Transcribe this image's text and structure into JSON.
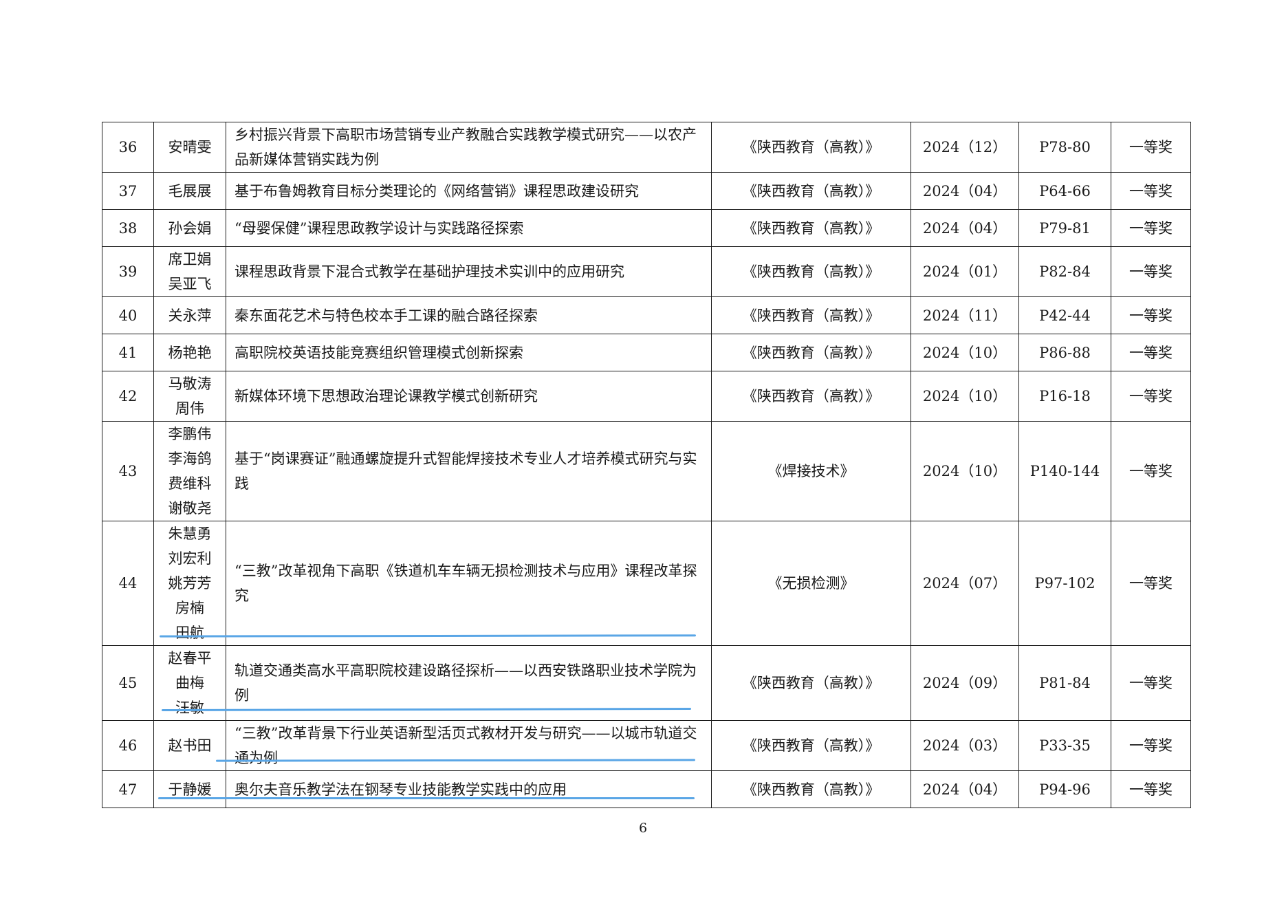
{
  "rows": [
    {
      "no": "36",
      "authors": [
        "安晴雯"
      ],
      "title": "乡村振兴背景下高职市场营销专业产教融合实践教学模式研究——以农产品新媒体营销实践为例",
      "journal": "《陕西教育（高教）》",
      "issue": "2024（12）",
      "pages": "P78-80",
      "award": "一等奖"
    },
    {
      "no": "37",
      "authors": [
        "毛展展"
      ],
      "title": "基于布鲁姆教育目标分类理论的《网络营销》课程思政建设研究",
      "journal": "《陕西教育（高教）》",
      "issue": "2024（04）",
      "pages": "P64-66",
      "award": "一等奖"
    },
    {
      "no": "38",
      "authors": [
        "孙会娟"
      ],
      "title": "“母婴保健”课程思政教学设计与实践路径探索",
      "journal": "《陕西教育（高教）》",
      "issue": "2024（04）",
      "pages": "P79-81",
      "award": "一等奖"
    },
    {
      "no": "39",
      "authors": [
        "席卫娟",
        "吴亚飞"
      ],
      "title": "课程思政背景下混合式教学在基础护理技术实训中的应用研究",
      "journal": "《陕西教育（高教）》",
      "issue": "2024（01）",
      "pages": "P82-84",
      "award": "一等奖"
    },
    {
      "no": "40",
      "authors": [
        "关永萍"
      ],
      "title": "秦东面花艺术与特色校本手工课的融合路径探索",
      "journal": "《陕西教育（高教）》",
      "issue": "2024（11）",
      "pages": "P42-44",
      "award": "一等奖"
    },
    {
      "no": "41",
      "authors": [
        "杨艳艳"
      ],
      "title": "高职院校英语技能竞赛组织管理模式创新探索",
      "journal": "《陕西教育（高教）》",
      "issue": "2024（10）",
      "pages": "P86-88",
      "award": "一等奖"
    },
    {
      "no": "42",
      "authors": [
        "马敬涛",
        "周伟"
      ],
      "title": "新媒体环境下思想政治理论课教学模式创新研究",
      "journal": "《陕西教育（高教）》",
      "issue": "2024（10）",
      "pages": "P16-18",
      "award": "一等奖"
    },
    {
      "no": "43",
      "authors": [
        "李鹏伟",
        "李海鸽",
        "费维科",
        "谢敬尧"
      ],
      "title": "基于“岗课赛证”融通螺旋提升式智能焊接技术专业人才培养模式研究与实践",
      "journal": "《焊接技术》",
      "issue": "2024（10）",
      "pages": "P140-144",
      "award": "一等奖"
    },
    {
      "no": "44",
      "authors": [
        "朱慧勇",
        "刘宏利",
        "姚芳芳",
        "房楠",
        "田航"
      ],
      "title": "“三教”改革视角下高职《铁道机车车辆无损检测技术与应用》课程改革探究",
      "journal": "《无损检测》",
      "issue": "2024（07）",
      "pages": "P97-102",
      "award": "一等奖"
    },
    {
      "no": "45",
      "authors": [
        "赵春平",
        "曲梅",
        "汪敏"
      ],
      "title": "轨道交通类高水平高职院校建设路径探析——以西安铁路职业技术学院为例",
      "journal": "《陕西教育（高教）》",
      "issue": "2024（09）",
      "pages": "P81-84",
      "award": "一等奖"
    },
    {
      "no": "46",
      "authors": [
        "赵书田"
      ],
      "title": "“三教”改革背景下行业英语新型活页式教材开发与研究——以城市轨道交通为例",
      "journal": "《陕西教育（高教）》",
      "issue": "2024（03）",
      "pages": "P33-35",
      "award": "一等奖"
    },
    {
      "no": "47",
      "authors": [
        "于静媛"
      ],
      "title": "奥尔夫音乐教学法在钢琴专业技能教学实践中的应用",
      "journal": "《陕西教育（高教）》",
      "issue": "2024（04）",
      "pages": "P94-96",
      "award": "一等奖"
    }
  ],
  "page_number": "6",
  "annotation_color": "#5aa6e6"
}
